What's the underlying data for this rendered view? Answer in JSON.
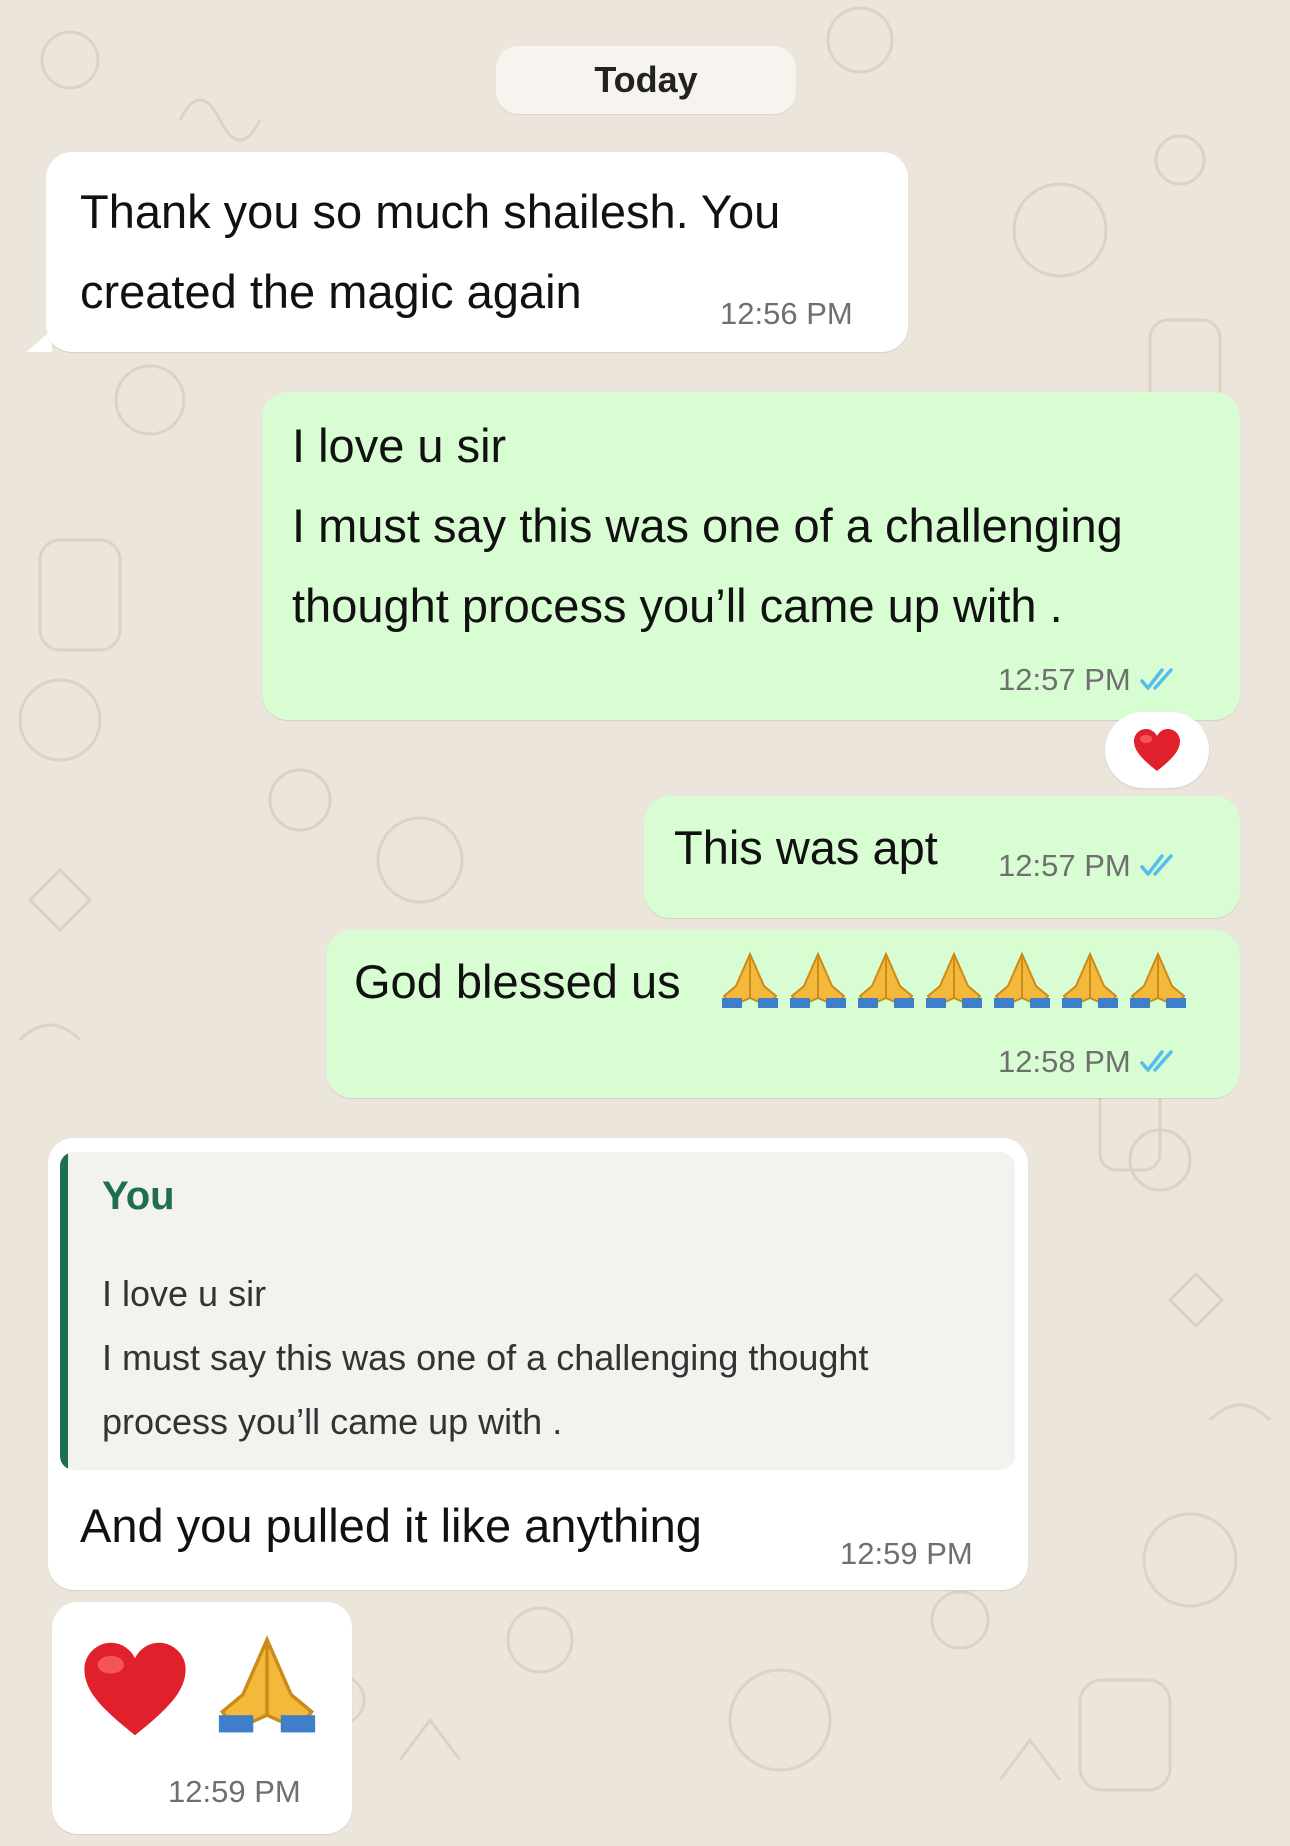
{
  "date_divider": "Today",
  "messages": [
    {
      "direction": "incoming",
      "text": "Thank you so much shailesh. You\ncreated the magic again",
      "time": "12:56 PM"
    },
    {
      "direction": "outgoing",
      "text": "I love u sir\nI must say this was one of a challenging\nthought process you’ll came up with .",
      "time": "12:57 PM",
      "status": "read",
      "reaction": "red-heart"
    },
    {
      "direction": "outgoing",
      "text": "This was apt",
      "time": "12:57 PM",
      "status": "read"
    },
    {
      "direction": "outgoing",
      "text": "God blessed us",
      "emoji": [
        "folded-hands",
        "folded-hands",
        "folded-hands",
        "folded-hands",
        "folded-hands",
        "folded-hands",
        "folded-hands"
      ],
      "time": "12:58 PM",
      "status": "read"
    },
    {
      "direction": "incoming",
      "reply_to": {
        "author": "You",
        "text": "I love u sir\nI must say this was one of a challenging thought\nprocess you’ll came up with ."
      },
      "text": "And you pulled it like anything",
      "time": "12:59 PM"
    },
    {
      "direction": "incoming",
      "emoji": [
        "red-heart",
        "folded-hands"
      ],
      "time": "12:59 PM"
    }
  ],
  "colors": {
    "background": "#ece5dc",
    "incoming_bubble": "#ffffff",
    "outgoing_bubble": "#d9fdd3",
    "read_ticks": "#53bdeb",
    "quote_accent": "#1f6f4e"
  }
}
